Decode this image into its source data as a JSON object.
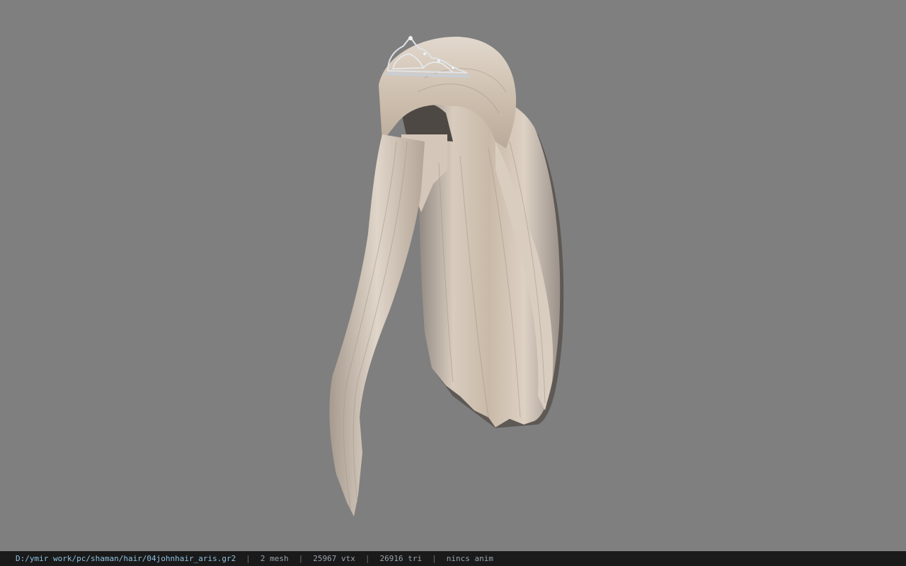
{
  "window": {
    "background_color": "#7f7f7f"
  },
  "viewport": {
    "model": {
      "name": "hair mesh with tiara",
      "hair_color": "#cdbfb0",
      "tiara_color": "#d9dde2"
    }
  },
  "statusbar": {
    "file_path": "D:/ymir work/pc/shaman/hair/04johnhair_aris.gr2",
    "mesh_count": "2 mesh",
    "vertex_count": "25967 vtx",
    "triangle_count": "26916 tri",
    "anim_status": "nincs anim",
    "separator": "|"
  }
}
